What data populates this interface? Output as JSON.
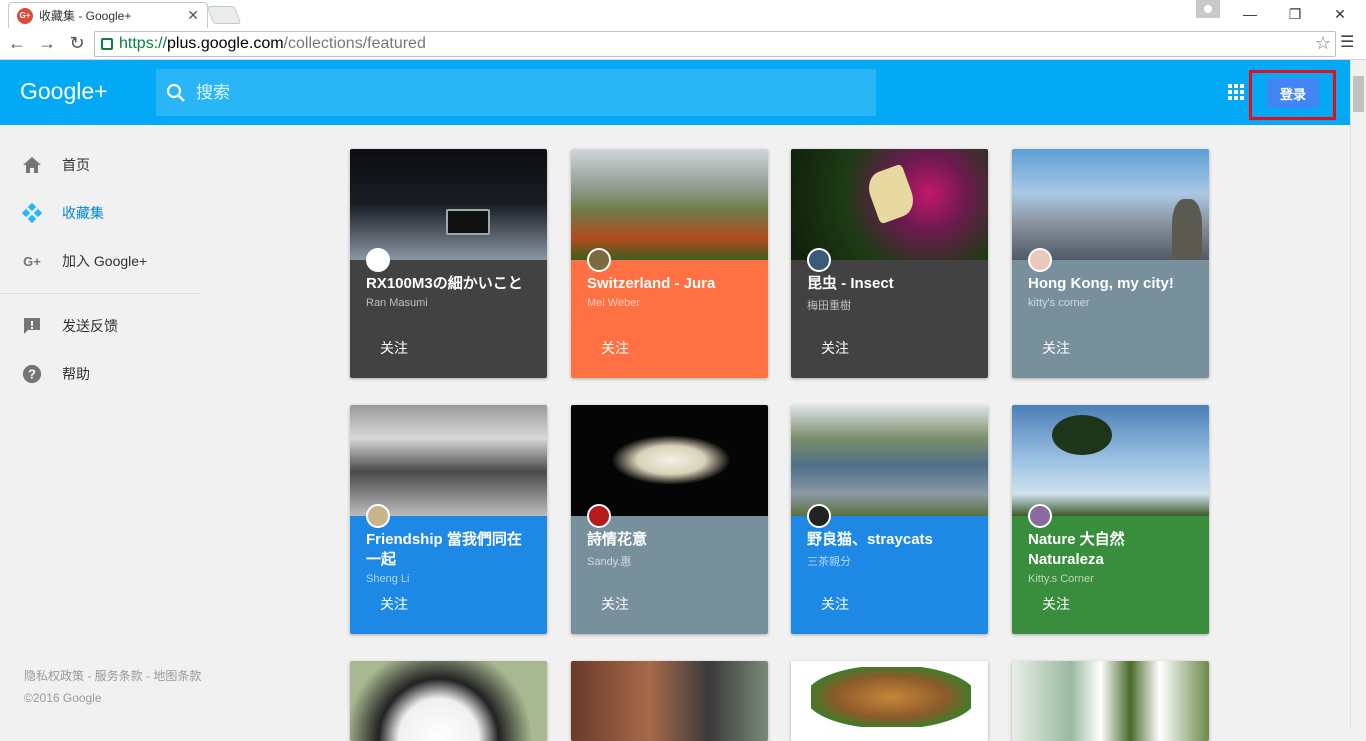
{
  "browser": {
    "tab_title": "收藏集 - Google+",
    "tab_favicon": "G+",
    "url_scheme": "https://",
    "url_host": "plus.google.com",
    "url_path": "/collections/featured"
  },
  "header": {
    "logo": "Google+",
    "search_placeholder": "搜索",
    "signin_label": "登录",
    "color": "#03a9f4"
  },
  "sidebar": {
    "items": [
      {
        "label": "首页",
        "icon": "home-icon"
      },
      {
        "label": "收藏集",
        "icon": "collections-icon",
        "active": true
      },
      {
        "label": "加入 Google+",
        "icon": "gplus-icon"
      },
      {
        "label": "发送反馈",
        "icon": "feedback-icon"
      },
      {
        "label": "帮助",
        "icon": "help-icon"
      }
    ],
    "footer_links": "隐私权政策 - 服务条款 - 地图条款",
    "copyright": "©2016 Google"
  },
  "cards": [
    {
      "title": "RX100M3の細かいこと",
      "author": "Ran Masumi",
      "follow": "关注",
      "color": "#424242"
    },
    {
      "title": "Switzerland - Jura",
      "author": "Mel Weber",
      "follow": "关注",
      "color": "#ff7043"
    },
    {
      "title": "昆虫 - Insect",
      "author": "梅田重樹",
      "follow": "关注",
      "color": "#424242"
    },
    {
      "title": "Hong Kong, my city!",
      "author": "kitty's corner",
      "follow": "关注",
      "color": "#78909c"
    },
    {
      "title": "Friendship 當我們同在一起",
      "author": "Sheng Li",
      "follow": "关注",
      "color": "#1e88e5"
    },
    {
      "title": "詩情花意",
      "author": "Sandy.惠",
      "follow": "关注",
      "color": "#78909c"
    },
    {
      "title": "野良猫、straycats",
      "author": "三茶親分",
      "follow": "关注",
      "color": "#1e88e5"
    },
    {
      "title": "Nature 大自然 Naturaleza",
      "author": "Kitty.s Corner",
      "follow": "关注",
      "color": "#388e3c"
    }
  ]
}
